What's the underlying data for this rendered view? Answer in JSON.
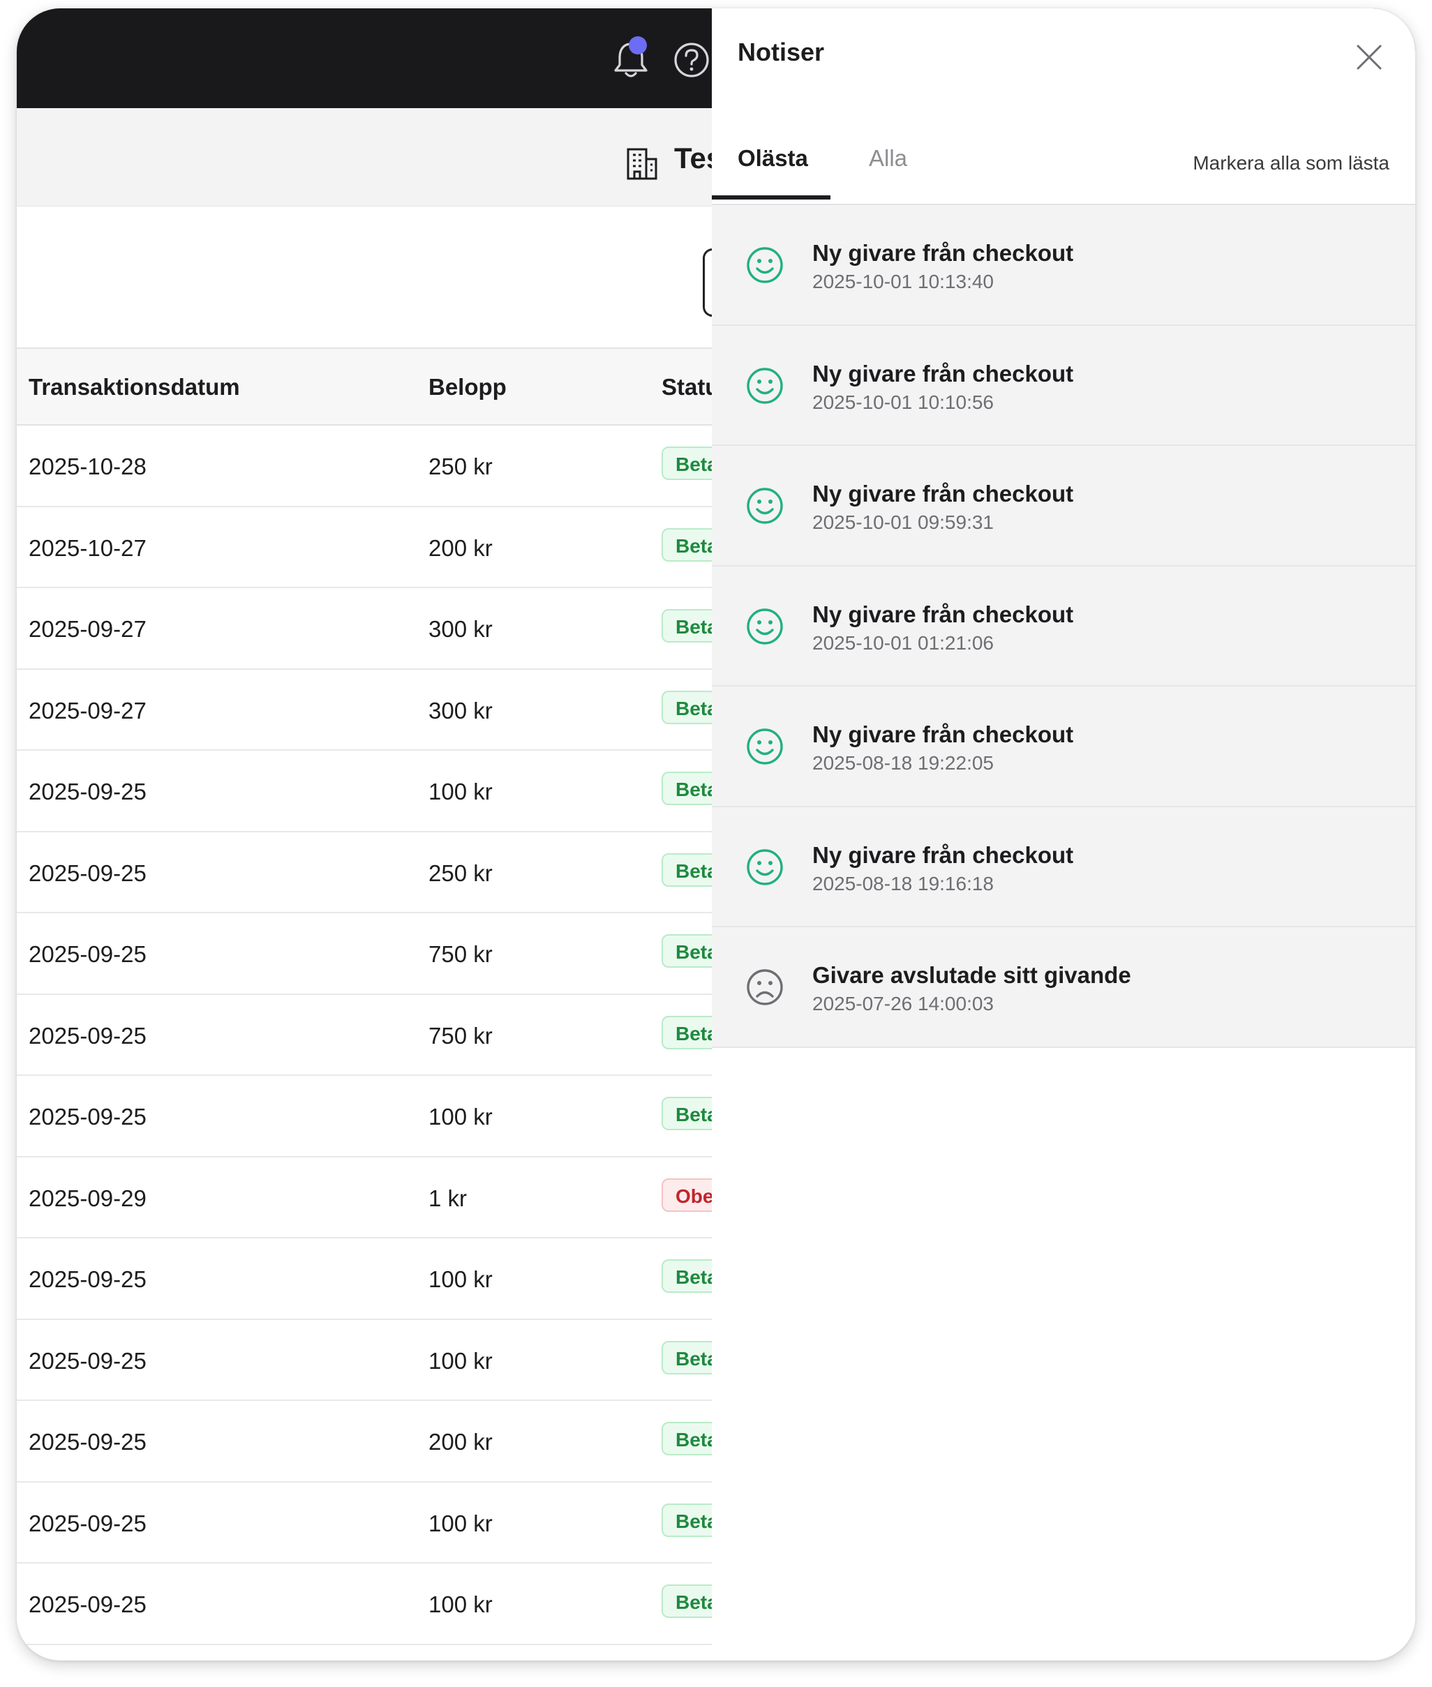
{
  "header": {
    "org_name": "Tes"
  },
  "table": {
    "columns": [
      "Transaktionsdatum",
      "Belopp",
      "Statu"
    ],
    "rows": [
      {
        "date": "2025-10-28",
        "amount": "250 kr",
        "status": "Beta",
        "status_type": "ok"
      },
      {
        "date": "2025-10-27",
        "amount": "200 kr",
        "status": "Beta",
        "status_type": "ok"
      },
      {
        "date": "2025-09-27",
        "amount": "300 kr",
        "status": "Beta",
        "status_type": "ok"
      },
      {
        "date": "2025-09-27",
        "amount": "300 kr",
        "status": "Beta",
        "status_type": "ok"
      },
      {
        "date": "2025-09-25",
        "amount": "100 kr",
        "status": "Beta",
        "status_type": "ok"
      },
      {
        "date": "2025-09-25",
        "amount": "250 kr",
        "status": "Beta",
        "status_type": "ok"
      },
      {
        "date": "2025-09-25",
        "amount": "750 kr",
        "status": "Beta",
        "status_type": "ok"
      },
      {
        "date": "2025-09-25",
        "amount": "750 kr",
        "status": "Beta",
        "status_type": "ok"
      },
      {
        "date": "2025-09-25",
        "amount": "100 kr",
        "status": "Beta",
        "status_type": "ok"
      },
      {
        "date": "2025-09-29",
        "amount": "1 kr",
        "status": "Obe",
        "status_type": "bad"
      },
      {
        "date": "2025-09-25",
        "amount": "100 kr",
        "status": "Beta",
        "status_type": "ok"
      },
      {
        "date": "2025-09-25",
        "amount": "100 kr",
        "status": "Beta",
        "status_type": "ok"
      },
      {
        "date": "2025-09-25",
        "amount": "200 kr",
        "status": "Beta",
        "status_type": "ok"
      },
      {
        "date": "2025-09-25",
        "amount": "100 kr",
        "status": "Beta",
        "status_type": "ok"
      },
      {
        "date": "2025-09-25",
        "amount": "100 kr",
        "status": "Beta",
        "status_type": "ok"
      }
    ]
  },
  "panel": {
    "title": "Notiser",
    "tabs": [
      {
        "label": "Olästa",
        "active": true
      },
      {
        "label": "Alla",
        "active": false
      }
    ],
    "mark_all_label": "Markera alla som lästa",
    "notifications": [
      {
        "title": "Ny givare från checkout",
        "time": "2025-10-01 10:13:40",
        "icon": "smile-icon"
      },
      {
        "title": "Ny givare från checkout",
        "time": "2025-10-01 10:10:56",
        "icon": "smile-icon"
      },
      {
        "title": "Ny givare från checkout",
        "time": "2025-10-01 09:59:31",
        "icon": "smile-icon"
      },
      {
        "title": "Ny givare från checkout",
        "time": "2025-10-01 01:21:06",
        "icon": "smile-icon"
      },
      {
        "title": "Ny givare från checkout",
        "time": "2025-08-18 19:22:05",
        "icon": "smile-icon"
      },
      {
        "title": "Ny givare från checkout",
        "time": "2025-08-18 19:16:18",
        "icon": "smile-icon"
      },
      {
        "title": "Givare avslutade sitt givande",
        "time": "2025-07-26 14:00:03",
        "icon": "frown-icon"
      }
    ]
  },
  "colors": {
    "topbar": "#19191b",
    "notification_dot": "#6d6cf5",
    "positive_icon": "#22b07d",
    "negative_icon": "#6e6e73",
    "badge_ok_text": "#1e8a3e",
    "badge_bad_text": "#c0262d"
  },
  "icons": {
    "topbar": [
      "bell-icon",
      "help-icon"
    ],
    "subheader": "building-icon",
    "panel_close": "close-icon"
  }
}
